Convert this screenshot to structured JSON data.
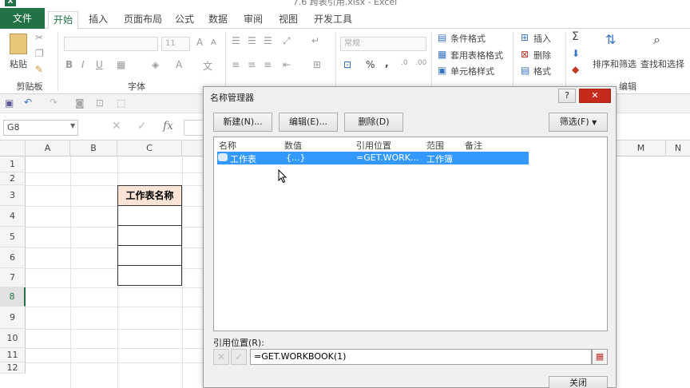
{
  "window": {
    "title": "7.6 跨表引用.xlsx - Excel",
    "app_icon": "X"
  },
  "ribbon_tabs": [
    "文件",
    "开始",
    "插入",
    "页面布局",
    "公式",
    "数据",
    "审阅",
    "视图",
    "开发工具"
  ],
  "ribbon": {
    "clipboard": {
      "paste": "粘贴",
      "group": "剪贴板"
    },
    "font": {
      "size": "11",
      "bold": "B",
      "italic": "I",
      "underline": "U",
      "group": "字体"
    },
    "number": {
      "format": "常规",
      "percent": "%",
      "comma": ","
    },
    "styles": {
      "conditional": "条件格式",
      "table": "套用表格格式",
      "cell": "单元格样式"
    },
    "cells": {
      "insert": "插入",
      "delete": "删除",
      "format": "格式"
    },
    "editing": {
      "sort": "排序和筛选",
      "find": "查找和选择",
      "group": "编辑"
    }
  },
  "formula_bar": {
    "name_box": "G8",
    "fx": "fx"
  },
  "columns": [
    "A",
    "B",
    "C",
    "M",
    "N"
  ],
  "rows": [
    "1",
    "2",
    "3",
    "4",
    "5",
    "6",
    "7",
    "8",
    "9",
    "10",
    "11",
    "12"
  ],
  "selected_row": "8",
  "sheet": {
    "header_cell": "工作表名称"
  },
  "dialog": {
    "title": "名称管理器",
    "help": "?",
    "buttons": {
      "new": "新建(N)...",
      "edit": "编辑(E)...",
      "delete": "删除(D)",
      "filter": "筛选(F)",
      "close": "关闭"
    },
    "columns": [
      "名称",
      "数值",
      "引用位置",
      "范围",
      "备注"
    ],
    "rows": [
      {
        "name": "工作表",
        "value": "{...}",
        "refers_to": "=GET.WORK...",
        "scope": "工作簿",
        "comment": ""
      }
    ],
    "refers_label": "引用位置(R):",
    "refers_value": "=GET.WORKBOOK(1)"
  },
  "colors": {
    "accent": "#217346",
    "selection": "#3399ff",
    "header_fill": "#fbe4d5"
  }
}
